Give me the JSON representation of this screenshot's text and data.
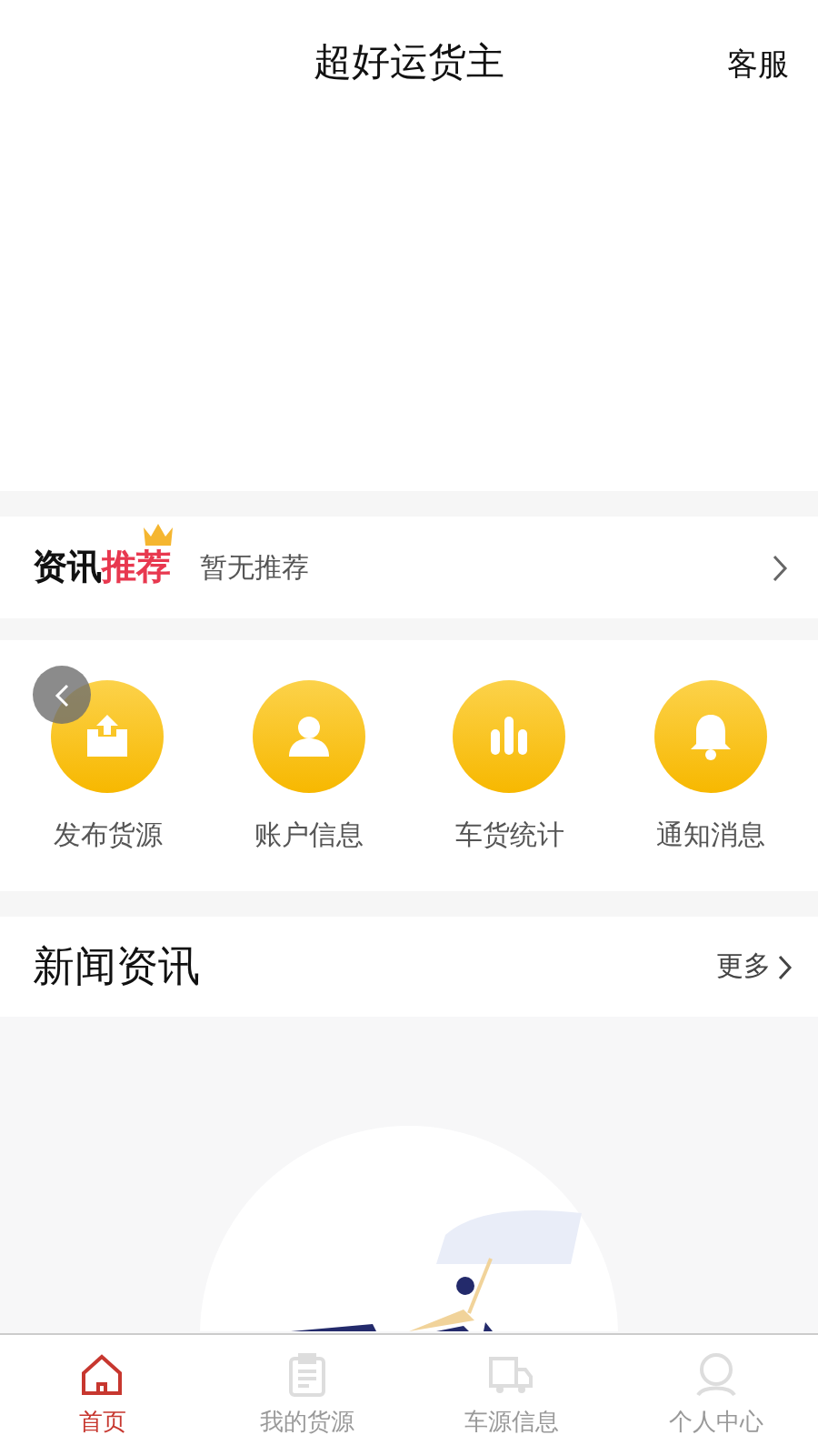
{
  "header": {
    "title": "超好运货主",
    "service": "客服"
  },
  "recommend": {
    "logo": [
      "资讯",
      "推荐"
    ],
    "text": "暂无推荐"
  },
  "shortcuts": [
    {
      "label": "发布货源",
      "kind": "upload"
    },
    {
      "label": "账户信息",
      "kind": "user"
    },
    {
      "label": "车货统计",
      "kind": "chart"
    },
    {
      "label": "通知消息",
      "kind": "bell"
    }
  ],
  "news": {
    "title": "新闻资讯",
    "more": "更多"
  },
  "tabs": [
    {
      "label": "首页",
      "kind": "home",
      "selected": true
    },
    {
      "label": "我的货源",
      "kind": "doc",
      "selected": false
    },
    {
      "label": "车源信息",
      "kind": "truck",
      "selected": false
    },
    {
      "label": "个人中心",
      "kind": "person",
      "selected": false
    }
  ]
}
